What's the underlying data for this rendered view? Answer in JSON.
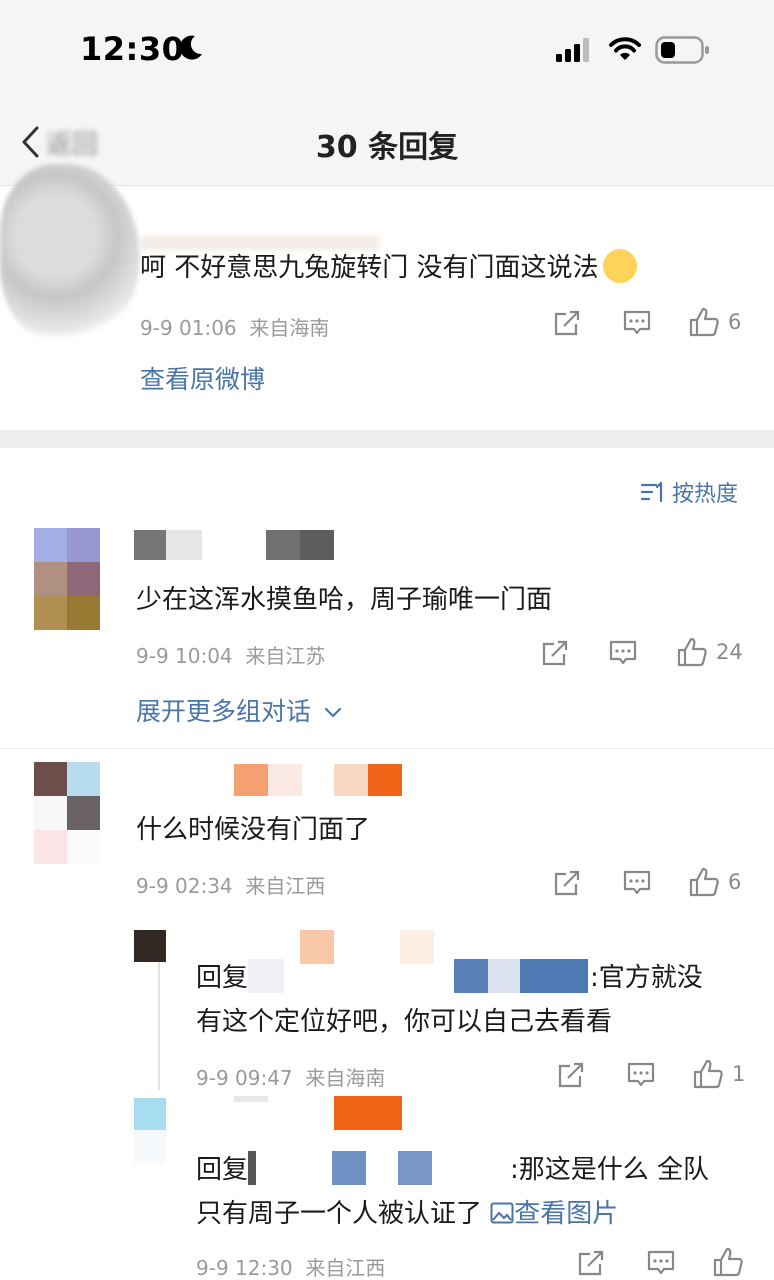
{
  "status": {
    "time": "12:30"
  },
  "nav": {
    "back_label": "返回",
    "title": "30 条回复"
  },
  "original": {
    "text": "呵 不好意思九兔旋转门 没有门面这说法",
    "time": "9-9 01:06",
    "location": "来自海南",
    "likes": "6",
    "view_original": "查看原微博"
  },
  "sort": {
    "label": "按热度"
  },
  "comments": [
    {
      "text": "少在这浑水摸鱼哈，周子瑜唯一门面",
      "time": "9-9 10:04",
      "location": "来自江苏",
      "likes": "24",
      "expand": "展开更多组对话"
    },
    {
      "text": "什么时候没有门面了",
      "time": "9-9 02:34",
      "location": "来自江西",
      "likes": "6"
    }
  ],
  "replies": [
    {
      "prefix": "回复",
      "line1_tail": ":官方就没",
      "line2": "有这个定位好吧，你可以自己去看看",
      "time": "9-9 09:47",
      "location": "来自海南",
      "likes": "1"
    },
    {
      "prefix": "回复",
      "line1_tail": ":那这是什么 全队",
      "line2": "只有周子一个人被认证了",
      "view_image": "查看图片",
      "time": "9-9 12:30",
      "location": "来自江西"
    }
  ],
  "colors": {
    "link": "#4a75a8",
    "meta": "#9a9a9a",
    "background": "#f5f5f5"
  }
}
